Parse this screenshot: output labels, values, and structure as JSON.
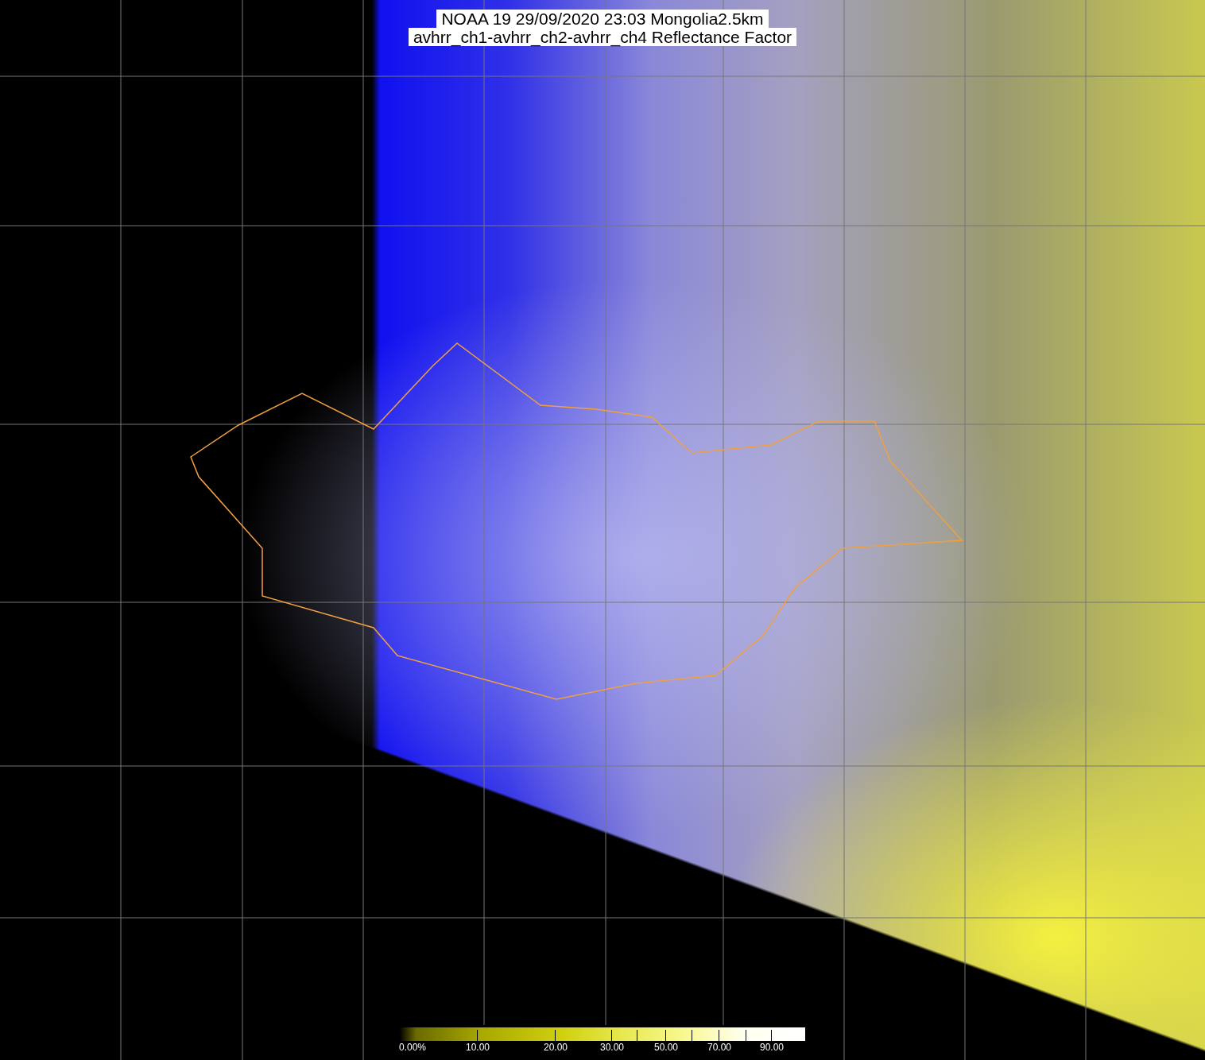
{
  "title": {
    "lines": [
      "NOAA 19 29/09/2020 23:03 Mongolia2.5km",
      "avhrr_ch1-avhrr_ch2-avhrr_ch4 Reflectance Factor"
    ]
  },
  "colorbar": {
    "labels": [
      "0.00%",
      "10.00",
      "20.00",
      "30.00",
      "50.00",
      "70.00",
      "90.00"
    ]
  }
}
